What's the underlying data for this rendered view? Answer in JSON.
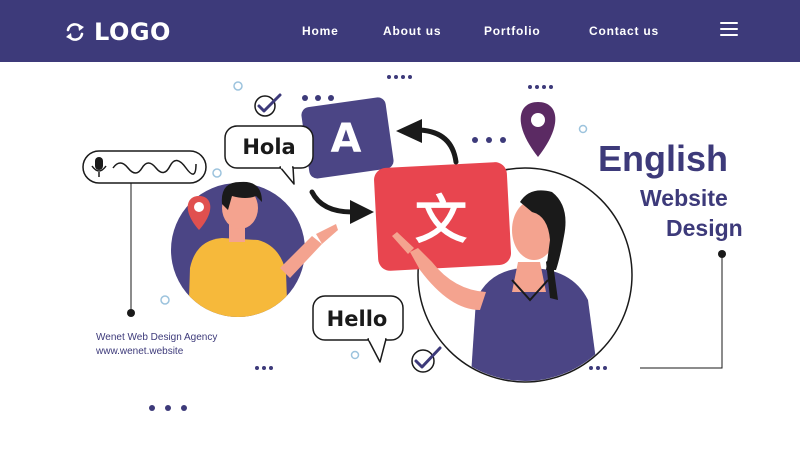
{
  "header": {
    "logo_text": "LOGO",
    "nav": [
      {
        "label": "Home"
      },
      {
        "label": "About us"
      },
      {
        "label": "Portfolio"
      },
      {
        "label": "Contact us"
      }
    ],
    "menu_icon": "hamburger-menu-icon"
  },
  "hero": {
    "headline_line1": "English",
    "headline_line2": "Website",
    "headline_line3": "Design",
    "agency_name": "Wenet Web Design Agency",
    "agency_url": "www.wenet.website",
    "bubble_hola": "Hola",
    "bubble_hello": "Hello",
    "card_latin": "A",
    "card_translate": "文"
  },
  "colors": {
    "navbar": "#3d3a7a",
    "brand_purple": "#3d3a7a",
    "card_purple": "#4b4585",
    "card_red": "#e8454f",
    "pin_red": "#e0504f",
    "pin_purple": "#5b2a63",
    "shirt_yellow": "#f6b93b",
    "shirt_purple": "#4b4585",
    "dot_blue": "#9cc3dd"
  }
}
